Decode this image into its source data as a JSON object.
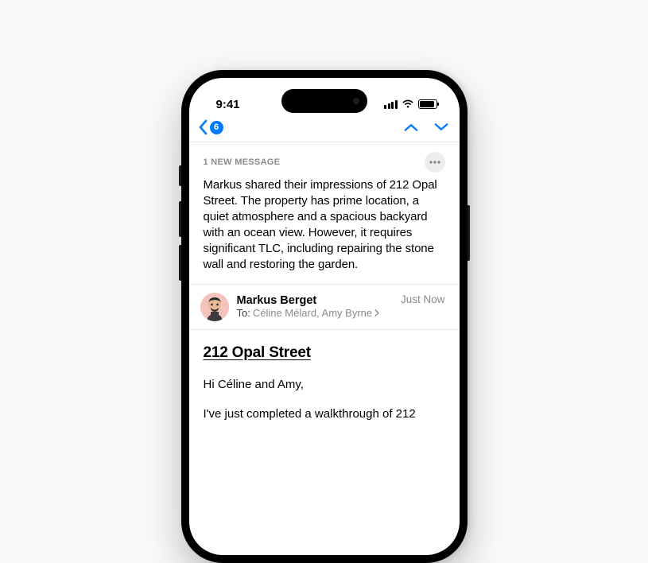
{
  "status": {
    "time": "9:41"
  },
  "nav": {
    "back_count": "6"
  },
  "summary": {
    "label": "1 NEW MESSAGE",
    "text": "Markus shared their impressions of 212 Opal Street. The property has prime location, a quiet atmosphere and a spacious backyard with an ocean view. However, it requires significant TLC, including repairing the stone wall and restoring the garden."
  },
  "sender": {
    "name": "Markus Berget",
    "to_label": "To:",
    "recipients": "Céline Mélard, Amy Byrne",
    "timestamp": "Just Now"
  },
  "email": {
    "subject": "212 Opal Street",
    "greeting": "Hi Céline and Amy,",
    "body1": "I've just completed a walkthrough of 212"
  }
}
